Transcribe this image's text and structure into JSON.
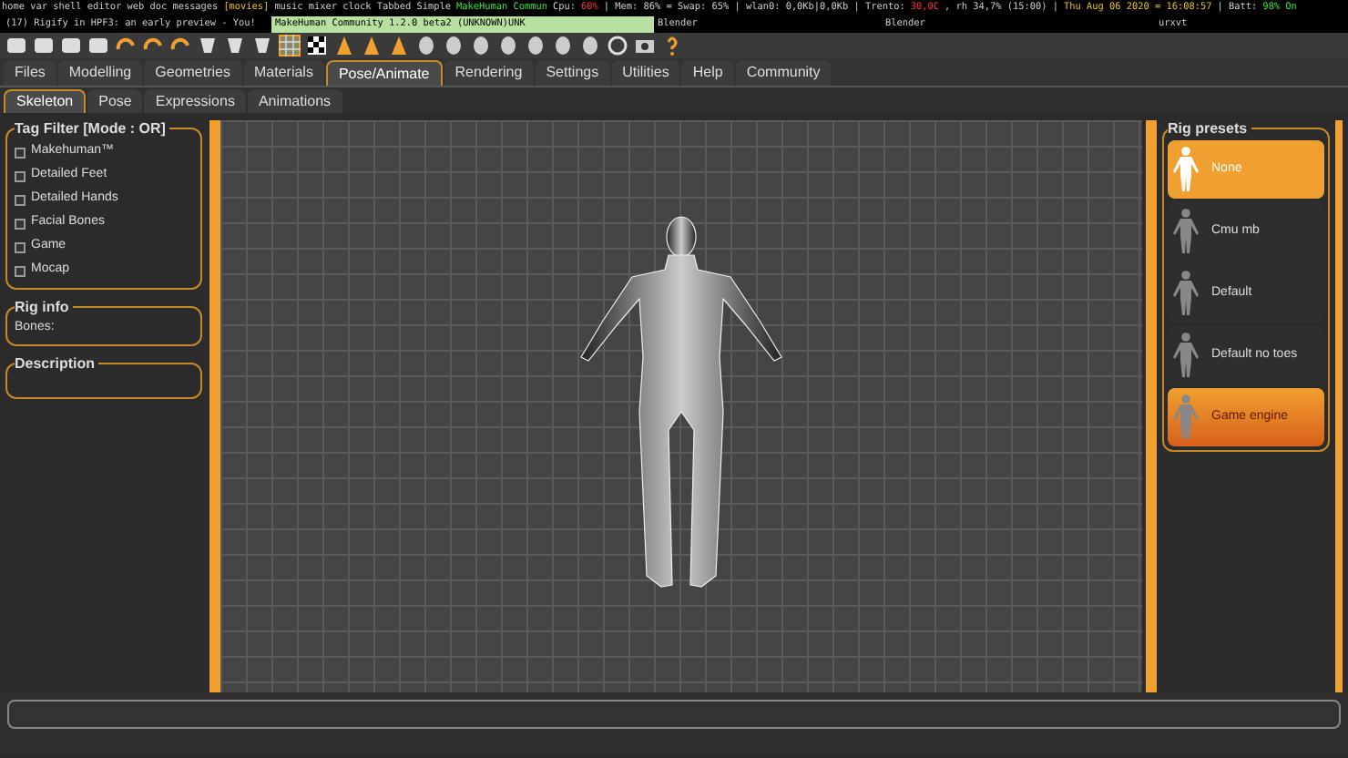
{
  "status_bar": {
    "segments": [
      {
        "text": "home var shell editor web doc messages",
        "kind": "plain"
      },
      {
        "text": "[movies]",
        "kind": "active"
      },
      {
        "text": "music mixer clock Tabbed Simple",
        "kind": "plain"
      },
      {
        "text": "MakeHuman Commun",
        "kind": "focus"
      },
      {
        "text": "Cpu:",
        "kind": "plain"
      },
      {
        "text": "60%",
        "kind": "alert"
      },
      {
        "text": "| Mem: 86% = Swap: 65% | wlan0: 0,0Kb|0,0Kb | Trento:",
        "kind": "plain"
      },
      {
        "text": "30,0C",
        "kind": "alert"
      },
      {
        "text": ", rh 34,7% (15:00) |",
        "kind": "plain"
      },
      {
        "text": "Thu Aug 06 2020 = 16:08:57",
        "kind": "active"
      },
      {
        "text": "| Batt:",
        "kind": "plain"
      },
      {
        "text": "98% On",
        "kind": "focus"
      }
    ]
  },
  "task_bar": {
    "tasks": [
      {
        "text": "(17) Rigify in HPF3: an early preview - You!",
        "selected": false
      },
      {
        "text": "MakeHuman Community 1.2.0 beta2 (UNKNOWN)UNK",
        "selected": true
      },
      {
        "text": "Blender",
        "selected": false
      },
      {
        "text": "Blender",
        "selected": false
      },
      {
        "text": "urxvt",
        "selected": false
      }
    ]
  },
  "tabs": [
    {
      "label": "Files",
      "selected": false
    },
    {
      "label": "Modelling",
      "selected": false
    },
    {
      "label": "Geometries",
      "selected": false
    },
    {
      "label": "Materials",
      "selected": false
    },
    {
      "label": "Pose/Animate",
      "selected": true
    },
    {
      "label": "Rendering",
      "selected": false
    },
    {
      "label": "Settings",
      "selected": false
    },
    {
      "label": "Utilities",
      "selected": false
    },
    {
      "label": "Help",
      "selected": false
    },
    {
      "label": "Community",
      "selected": false
    }
  ],
  "subtabs": [
    {
      "label": "Skeleton",
      "selected": true
    },
    {
      "label": "Pose",
      "selected": false
    },
    {
      "label": "Expressions",
      "selected": false
    },
    {
      "label": "Animations",
      "selected": false
    }
  ],
  "tag_filter": {
    "title": "Tag Filter [Mode : OR]",
    "items": [
      {
        "label": "Makehuman™",
        "checked": false
      },
      {
        "label": "Detailed Feet",
        "checked": false
      },
      {
        "label": "Detailed Hands",
        "checked": false
      },
      {
        "label": "Facial Bones",
        "checked": false
      },
      {
        "label": "Game",
        "checked": false
      },
      {
        "label": "Mocap",
        "checked": false
      }
    ]
  },
  "rig_info": {
    "title": "Rig info",
    "text": "Bones:"
  },
  "description": {
    "title": "Description"
  },
  "rig_presets": {
    "title": "Rig presets",
    "items": [
      {
        "label": "None",
        "selected": true,
        "hovered": false
      },
      {
        "label": "Cmu mb",
        "selected": false,
        "hovered": false
      },
      {
        "label": "Default",
        "selected": false,
        "hovered": false
      },
      {
        "label": "Default no toes",
        "selected": false,
        "hovered": false
      },
      {
        "label": "Game engine",
        "selected": false,
        "hovered": true
      }
    ]
  }
}
